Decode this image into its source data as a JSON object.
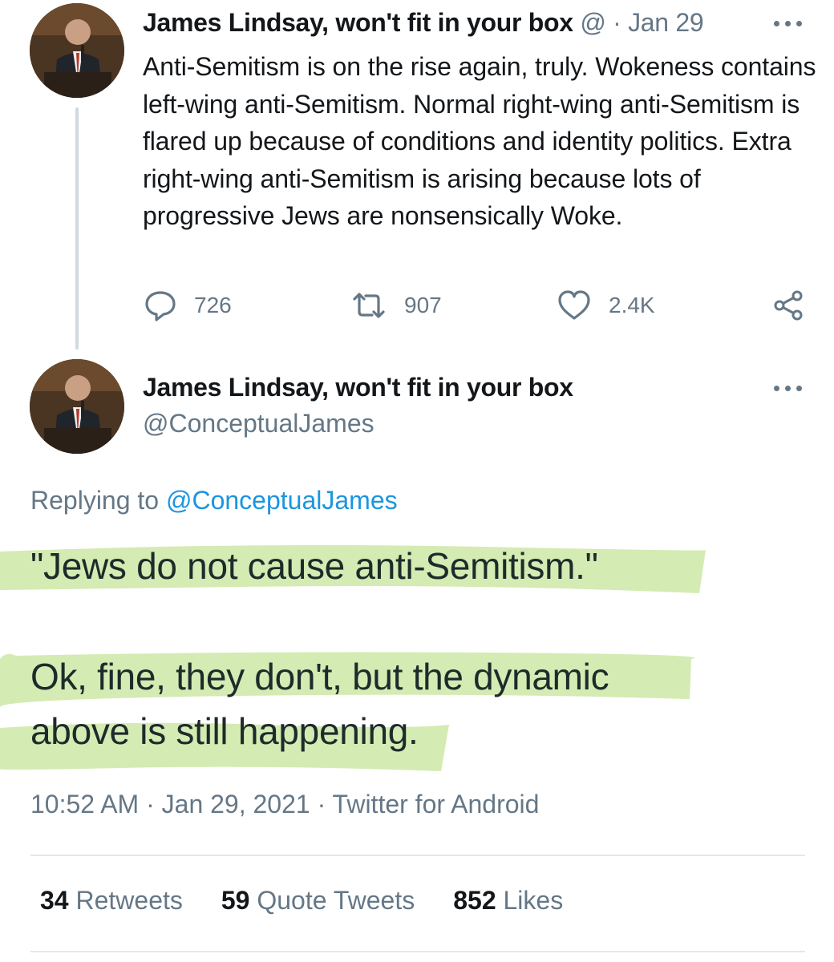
{
  "tweet1": {
    "name": "James Lindsay, won't fit in your box",
    "handle_truncated": "@",
    "sep": "·",
    "date": "Jan 29",
    "text": "Anti-Semitism is on the rise again, truly. Wokeness contains left-wing anti-Semitism. Normal right-wing anti-Semitism is flared up because of conditions and identity politics. Extra right-wing anti-Semitism is arising because lots of progressive Jews are nonsensically Woke.",
    "replies": "726",
    "retweets": "907",
    "likes": "2.4K"
  },
  "tweet2": {
    "name": "James Lindsay, won't fit in your box",
    "handle": "@ConceptualJames",
    "replying_prefix": "Replying to",
    "replying_handle": "@ConceptualJames",
    "line1": "\"Jews do not cause anti-Semitism.\"",
    "line2": "Ok, fine, they don't, but the dynamic",
    "line3": "above is still happening.",
    "time": "10:52 AM",
    "date": "Jan 29, 2021",
    "sep": "·",
    "source": "Twitter for Android"
  },
  "stats": {
    "retweets_count": "34",
    "retweets_label": "Retweets",
    "quotes_count": "59",
    "quotes_label": "Quote Tweets",
    "likes_count": "852",
    "likes_label": "Likes"
  },
  "icons": {
    "reply": "reply-icon",
    "retweet": "retweet-icon",
    "like": "heart-icon",
    "share": "share-icon",
    "more": "more-icon"
  },
  "colors": {
    "text": "#14171a",
    "secondary": "#657786",
    "link": "#1b95e0",
    "highlight": "#cde8a6"
  }
}
